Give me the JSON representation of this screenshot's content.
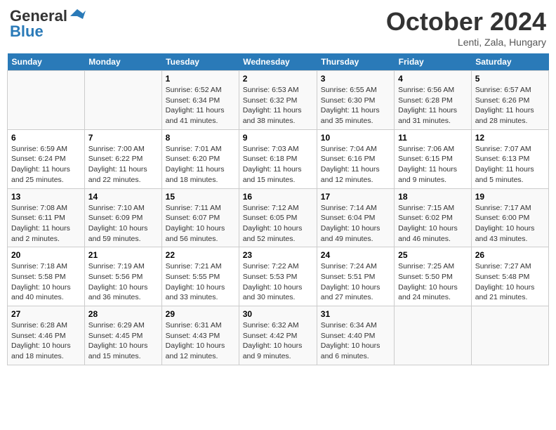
{
  "header": {
    "logo_line1": "General",
    "logo_line2": "Blue",
    "month_title": "October 2024",
    "location": "Lenti, Zala, Hungary"
  },
  "days_of_week": [
    "Sunday",
    "Monday",
    "Tuesday",
    "Wednesday",
    "Thursday",
    "Friday",
    "Saturday"
  ],
  "weeks": [
    [
      null,
      null,
      {
        "day": 1,
        "sunrise": "6:52 AM",
        "sunset": "6:34 PM",
        "daylight": "11 hours and 41 minutes."
      },
      {
        "day": 2,
        "sunrise": "6:53 AM",
        "sunset": "6:32 PM",
        "daylight": "11 hours and 38 minutes."
      },
      {
        "day": 3,
        "sunrise": "6:55 AM",
        "sunset": "6:30 PM",
        "daylight": "11 hours and 35 minutes."
      },
      {
        "day": 4,
        "sunrise": "6:56 AM",
        "sunset": "6:28 PM",
        "daylight": "11 hours and 31 minutes."
      },
      {
        "day": 5,
        "sunrise": "6:57 AM",
        "sunset": "6:26 PM",
        "daylight": "11 hours and 28 minutes."
      }
    ],
    [
      {
        "day": 6,
        "sunrise": "6:59 AM",
        "sunset": "6:24 PM",
        "daylight": "11 hours and 25 minutes."
      },
      {
        "day": 7,
        "sunrise": "7:00 AM",
        "sunset": "6:22 PM",
        "daylight": "11 hours and 22 minutes."
      },
      {
        "day": 8,
        "sunrise": "7:01 AM",
        "sunset": "6:20 PM",
        "daylight": "11 hours and 18 minutes."
      },
      {
        "day": 9,
        "sunrise": "7:03 AM",
        "sunset": "6:18 PM",
        "daylight": "11 hours and 15 minutes."
      },
      {
        "day": 10,
        "sunrise": "7:04 AM",
        "sunset": "6:16 PM",
        "daylight": "11 hours and 12 minutes."
      },
      {
        "day": 11,
        "sunrise": "7:06 AM",
        "sunset": "6:15 PM",
        "daylight": "11 hours and 9 minutes."
      },
      {
        "day": 12,
        "sunrise": "7:07 AM",
        "sunset": "6:13 PM",
        "daylight": "11 hours and 5 minutes."
      }
    ],
    [
      {
        "day": 13,
        "sunrise": "7:08 AM",
        "sunset": "6:11 PM",
        "daylight": "11 hours and 2 minutes."
      },
      {
        "day": 14,
        "sunrise": "7:10 AM",
        "sunset": "6:09 PM",
        "daylight": "10 hours and 59 minutes."
      },
      {
        "day": 15,
        "sunrise": "7:11 AM",
        "sunset": "6:07 PM",
        "daylight": "10 hours and 56 minutes."
      },
      {
        "day": 16,
        "sunrise": "7:12 AM",
        "sunset": "6:05 PM",
        "daylight": "10 hours and 52 minutes."
      },
      {
        "day": 17,
        "sunrise": "7:14 AM",
        "sunset": "6:04 PM",
        "daylight": "10 hours and 49 minutes."
      },
      {
        "day": 18,
        "sunrise": "7:15 AM",
        "sunset": "6:02 PM",
        "daylight": "10 hours and 46 minutes."
      },
      {
        "day": 19,
        "sunrise": "7:17 AM",
        "sunset": "6:00 PM",
        "daylight": "10 hours and 43 minutes."
      }
    ],
    [
      {
        "day": 20,
        "sunrise": "7:18 AM",
        "sunset": "5:58 PM",
        "daylight": "10 hours and 40 minutes."
      },
      {
        "day": 21,
        "sunrise": "7:19 AM",
        "sunset": "5:56 PM",
        "daylight": "10 hours and 36 minutes."
      },
      {
        "day": 22,
        "sunrise": "7:21 AM",
        "sunset": "5:55 PM",
        "daylight": "10 hours and 33 minutes."
      },
      {
        "day": 23,
        "sunrise": "7:22 AM",
        "sunset": "5:53 PM",
        "daylight": "10 hours and 30 minutes."
      },
      {
        "day": 24,
        "sunrise": "7:24 AM",
        "sunset": "5:51 PM",
        "daylight": "10 hours and 27 minutes."
      },
      {
        "day": 25,
        "sunrise": "7:25 AM",
        "sunset": "5:50 PM",
        "daylight": "10 hours and 24 minutes."
      },
      {
        "day": 26,
        "sunrise": "7:27 AM",
        "sunset": "5:48 PM",
        "daylight": "10 hours and 21 minutes."
      }
    ],
    [
      {
        "day": 27,
        "sunrise": "6:28 AM",
        "sunset": "4:46 PM",
        "daylight": "10 hours and 18 minutes."
      },
      {
        "day": 28,
        "sunrise": "6:29 AM",
        "sunset": "4:45 PM",
        "daylight": "10 hours and 15 minutes."
      },
      {
        "day": 29,
        "sunrise": "6:31 AM",
        "sunset": "4:43 PM",
        "daylight": "10 hours and 12 minutes."
      },
      {
        "day": 30,
        "sunrise": "6:32 AM",
        "sunset": "4:42 PM",
        "daylight": "10 hours and 9 minutes."
      },
      {
        "day": 31,
        "sunrise": "6:34 AM",
        "sunset": "4:40 PM",
        "daylight": "10 hours and 6 minutes."
      },
      null,
      null
    ]
  ]
}
